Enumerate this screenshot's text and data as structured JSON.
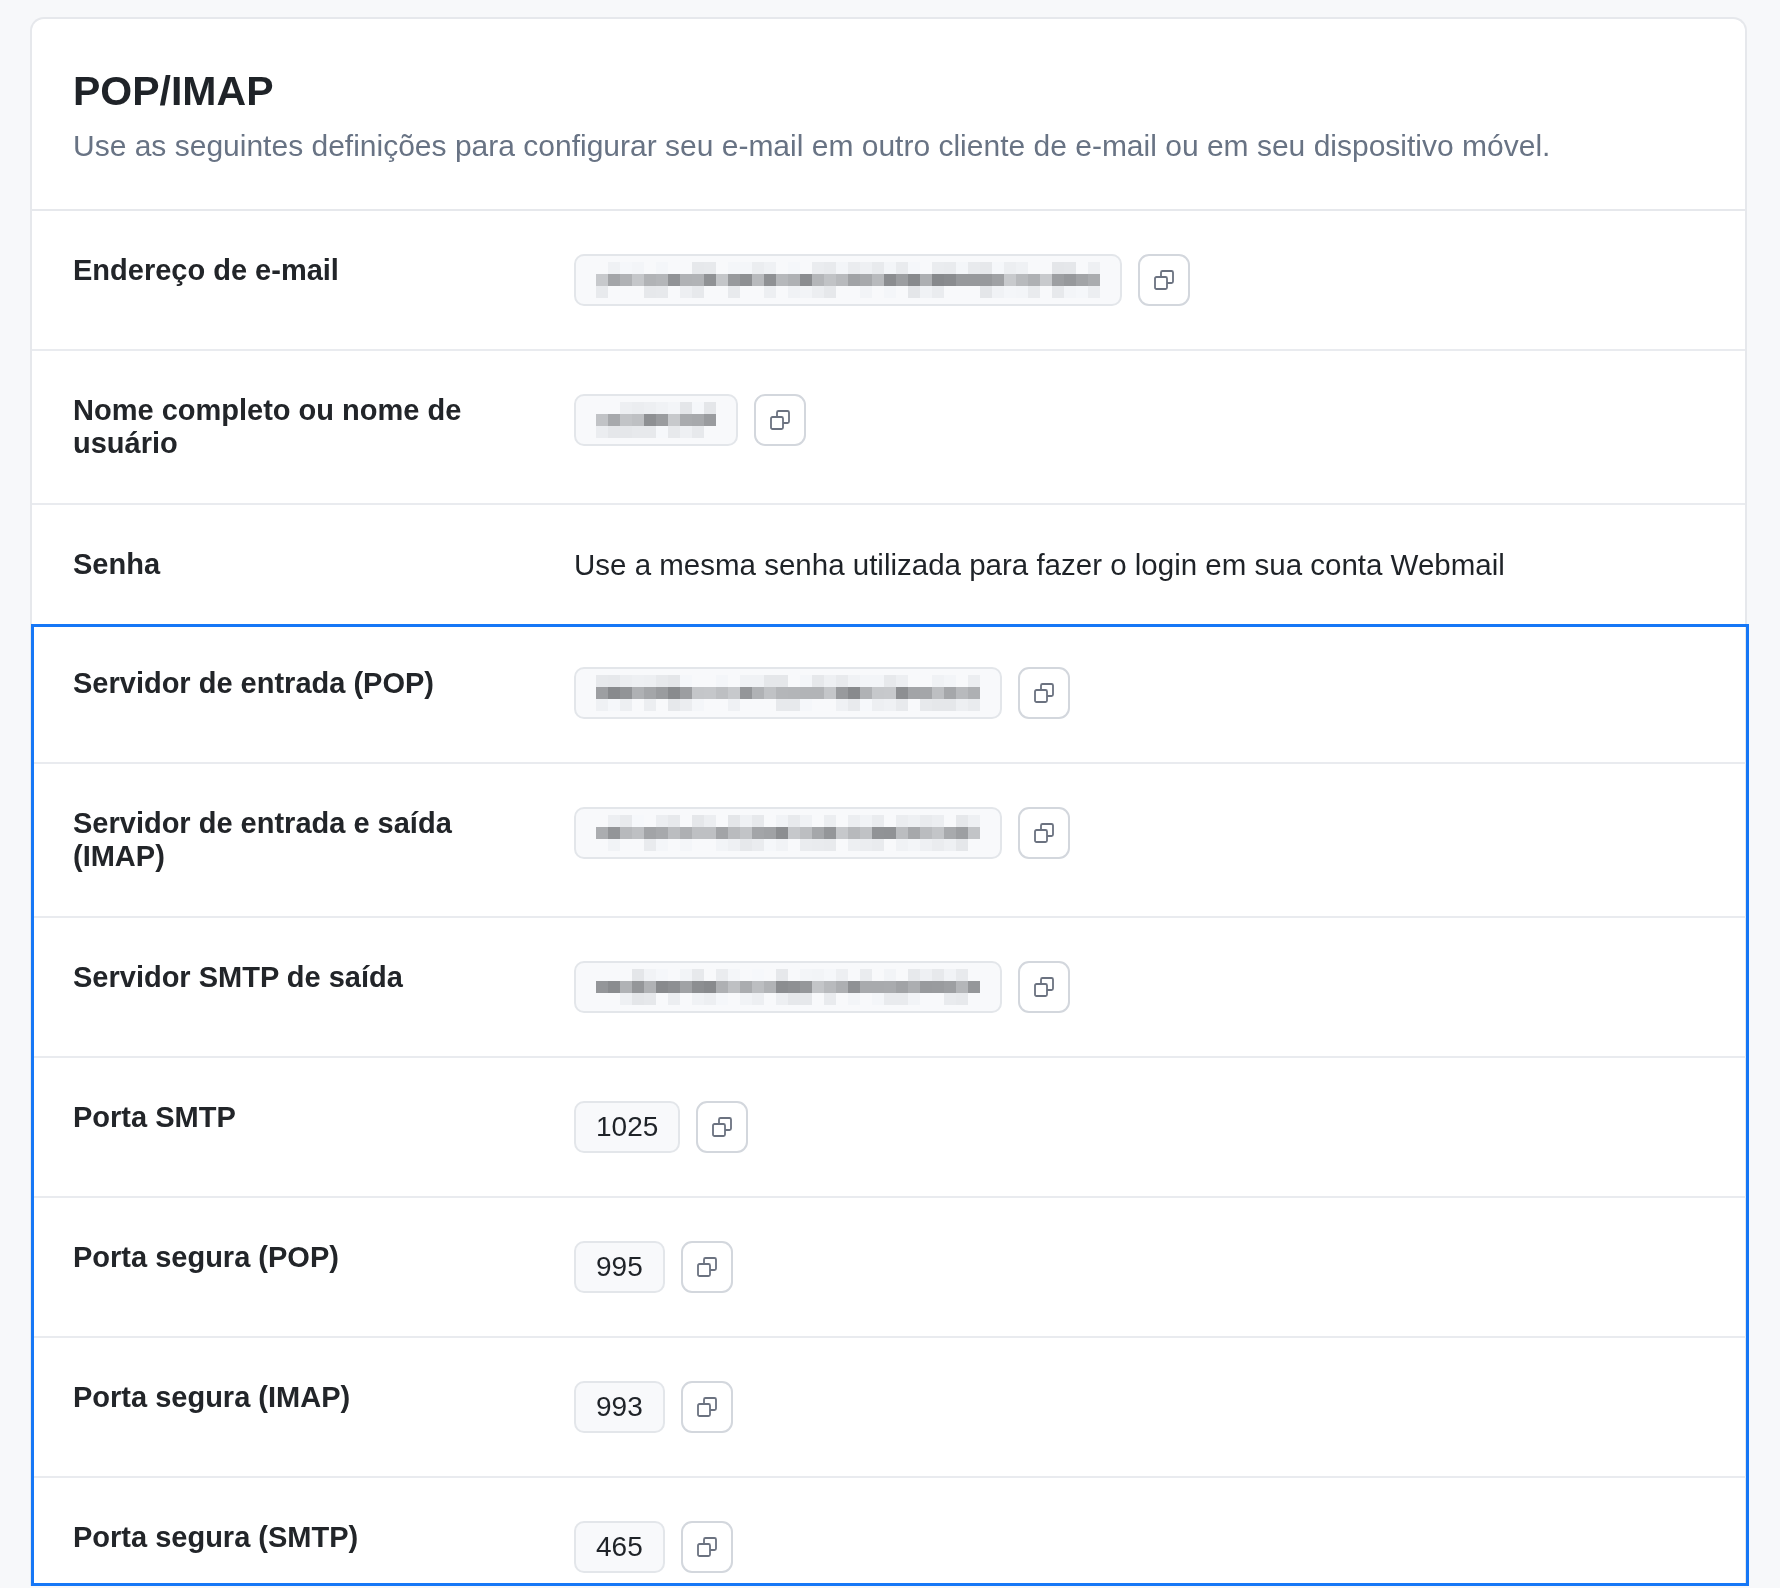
{
  "card": {
    "title": "POP/IMAP",
    "description": "Use as seguintes definições para configurar seu e-mail em outro cliente de e-mail ou em seu dispositivo móvel."
  },
  "sections": [
    {
      "highlighted": false,
      "rows": [
        {
          "kind": "copy_field",
          "label": "Endereço de e-mail",
          "redacted": true
        },
        {
          "kind": "copy_field",
          "label": "Nome completo ou nome de usuário",
          "redacted": true
        },
        {
          "kind": "note",
          "label": "Senha",
          "text": "Use a mesma senha utilizada para fazer o login em sua conta Webmail"
        }
      ]
    },
    {
      "highlighted": true,
      "rows": [
        {
          "kind": "copy_field",
          "label": "Servidor de entrada (POP)",
          "redacted": true
        },
        {
          "kind": "copy_field",
          "label": "Servidor de entrada e saída (IMAP)",
          "redacted": true
        },
        {
          "kind": "copy_field",
          "label": "Servidor SMTP de saída",
          "redacted": true
        },
        {
          "kind": "copy_field",
          "label": "Porta SMTP",
          "redacted": false,
          "value": "1025"
        },
        {
          "kind": "copy_field",
          "label": "Porta segura (POP)",
          "redacted": false,
          "value": "995"
        },
        {
          "kind": "copy_field",
          "label": "Porta segura (IMAP)",
          "redacted": false,
          "value": "993"
        },
        {
          "kind": "copy_field",
          "label": "Porta segura (SMTP)",
          "redacted": false,
          "value": "465"
        }
      ]
    }
  ]
}
